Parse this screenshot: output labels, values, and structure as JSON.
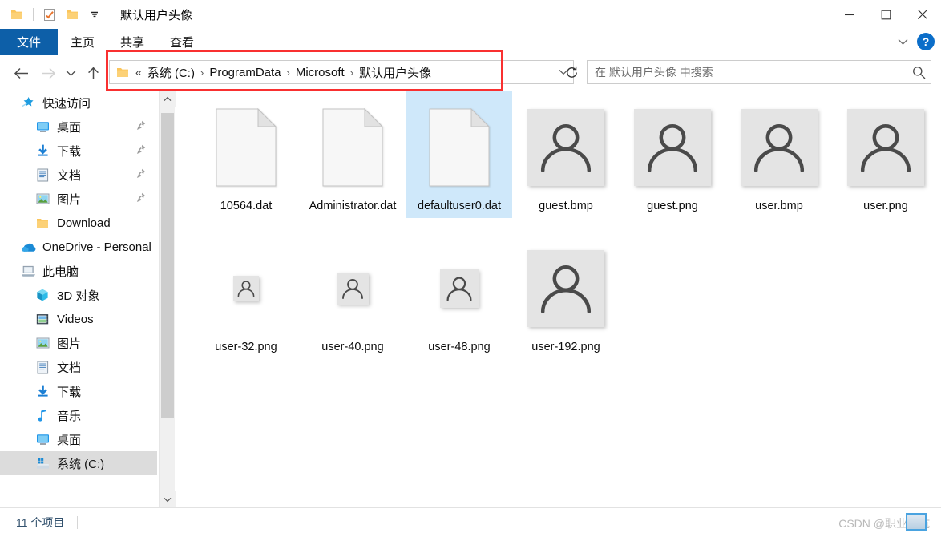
{
  "window": {
    "title": "默认用户头像",
    "quick_access": [
      {
        "name": "folder-icon"
      },
      {
        "name": "properties-icon"
      },
      {
        "name": "new-folder-icon"
      },
      {
        "name": "customize-dropdown-icon"
      }
    ],
    "controls": {
      "minimize": "minimize-icon",
      "maximize": "maximize-icon",
      "close": "close-icon"
    }
  },
  "ribbon": {
    "tabs": [
      {
        "label": "文件",
        "active": true
      },
      {
        "label": "主页",
        "active": false
      },
      {
        "label": "共享",
        "active": false
      },
      {
        "label": "查看",
        "active": false
      }
    ],
    "collapse_label": "chevron-down-icon",
    "help_label": "?"
  },
  "nav": {
    "back": "back-arrow-icon",
    "forward": "forward-arrow-icon",
    "recent": "recent-locations-icon",
    "up": "up-arrow-icon"
  },
  "address": {
    "prefix": "«",
    "crumbs": [
      "系统 (C:)",
      "ProgramData",
      "Microsoft",
      "默认用户头像"
    ],
    "separator": "›",
    "dropdown": "chevron-down-icon",
    "refresh": "refresh-icon"
  },
  "search": {
    "placeholder": "在 默认用户头像 中搜索",
    "icon": "search-icon"
  },
  "sidebar": {
    "items": [
      {
        "label": "快速访问",
        "icon": "quick-access-star-icon",
        "level": 0,
        "pinned": false,
        "selected": false
      },
      {
        "label": "桌面",
        "icon": "desktop-icon",
        "level": 1,
        "pinned": true,
        "selected": false
      },
      {
        "label": "下载",
        "icon": "downloads-icon",
        "level": 1,
        "pinned": true,
        "selected": false
      },
      {
        "label": "文档",
        "icon": "documents-icon",
        "level": 1,
        "pinned": true,
        "selected": false
      },
      {
        "label": "图片",
        "icon": "pictures-icon",
        "level": 1,
        "pinned": true,
        "selected": false
      },
      {
        "label": "Download",
        "icon": "folder-icon",
        "level": 1,
        "pinned": false,
        "selected": false
      },
      {
        "label": "OneDrive - Personal",
        "icon": "onedrive-icon",
        "level": 0,
        "pinned": false,
        "selected": false
      },
      {
        "label": "此电脑",
        "icon": "this-pc-icon",
        "level": 0,
        "pinned": false,
        "selected": false
      },
      {
        "label": "3D 对象",
        "icon": "3d-objects-icon",
        "level": 1,
        "pinned": false,
        "selected": false
      },
      {
        "label": "Videos",
        "icon": "videos-icon",
        "level": 1,
        "pinned": false,
        "selected": false
      },
      {
        "label": "图片",
        "icon": "pictures-icon",
        "level": 1,
        "pinned": false,
        "selected": false
      },
      {
        "label": "文档",
        "icon": "documents-icon",
        "level": 1,
        "pinned": false,
        "selected": false
      },
      {
        "label": "下载",
        "icon": "downloads-icon",
        "level": 1,
        "pinned": false,
        "selected": false
      },
      {
        "label": "音乐",
        "icon": "music-icon",
        "level": 1,
        "pinned": false,
        "selected": false
      },
      {
        "label": "桌面",
        "icon": "desktop-icon",
        "level": 1,
        "pinned": false,
        "selected": false
      },
      {
        "label": "系统 (C:)",
        "icon": "local-disk-icon",
        "level": 1,
        "pinned": false,
        "selected": true
      }
    ],
    "scrollbar": {
      "up": "scroll-up-icon",
      "down": "scroll-down-icon"
    }
  },
  "files": [
    {
      "name": "10564.dat",
      "icon": "blank-document-icon",
      "type": "document",
      "selected": false,
      "thumb_size": 0
    },
    {
      "name": "Administrator.dat",
      "icon": "blank-document-icon",
      "type": "document",
      "selected": false,
      "thumb_size": 0
    },
    {
      "name": "defaultuser0.dat",
      "icon": "blank-document-icon",
      "type": "document",
      "selected": true,
      "thumb_size": 0
    },
    {
      "name": "guest.bmp",
      "icon": "user-avatar-icon",
      "type": "image",
      "selected": false,
      "thumb_size": 96
    },
    {
      "name": "guest.png",
      "icon": "user-avatar-icon",
      "type": "image",
      "selected": false,
      "thumb_size": 96
    },
    {
      "name": "user.bmp",
      "icon": "user-avatar-icon",
      "type": "image",
      "selected": false,
      "thumb_size": 96
    },
    {
      "name": "user.png",
      "icon": "user-avatar-icon",
      "type": "image",
      "selected": false,
      "thumb_size": 96
    },
    {
      "name": "user-32.png",
      "icon": "user-avatar-icon",
      "type": "image",
      "selected": false,
      "thumb_size": 32
    },
    {
      "name": "user-40.png",
      "icon": "user-avatar-icon",
      "type": "image",
      "selected": false,
      "thumb_size": 40
    },
    {
      "name": "user-48.png",
      "icon": "user-avatar-icon",
      "type": "image",
      "selected": false,
      "thumb_size": 48
    },
    {
      "name": "user-192.png",
      "icon": "user-avatar-icon",
      "type": "image",
      "selected": false,
      "thumb_size": 96
    }
  ],
  "status": {
    "item_count": "11 个项目"
  },
  "watermark": {
    "text": "CSDN @职业填坑"
  },
  "annotation": {
    "color": "#f93030",
    "target": "address-bar"
  },
  "colors": {
    "accent": "#0d5fa8",
    "selection": "#cfe8fa",
    "sidebar_selection": "#dcdcdc",
    "avatar_bg": "#e4e4e4",
    "avatar_fg": "#4a4a4a"
  }
}
